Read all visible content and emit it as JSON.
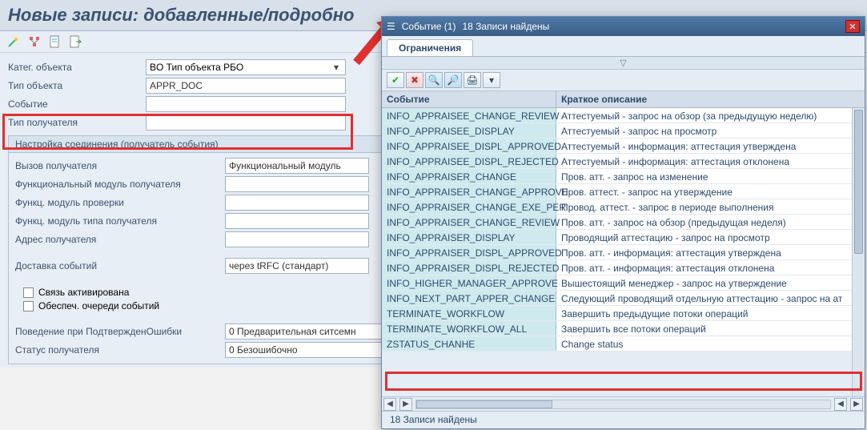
{
  "page_title": "Новые записи: добавленные/подробно",
  "toolbar_icons": [
    "wand-icon",
    "structure-icon",
    "document-icon",
    "forward-icon"
  ],
  "form": {
    "object_category_label": "Катег. объекта",
    "object_category_value": "BO Тип объекта РБО",
    "object_type_label": "Тип объекта",
    "object_type_value": "APPR_DOC",
    "event_label": "Событие",
    "event_value": "",
    "receiver_type_label": "Тип получателя",
    "receiver_type_value": ""
  },
  "group": {
    "header": "Настройка соединения (получатель события)",
    "rows": [
      {
        "label": "Вызов получателя",
        "value": "Функциональный модуль"
      },
      {
        "label": "Функциональный модуль получателя",
        "value": ""
      },
      {
        "label": "Функц. модуль проверки",
        "value": ""
      },
      {
        "label": "Функц. модуль типа получателя",
        "value": ""
      },
      {
        "label": "Адрес получателя",
        "value": ""
      }
    ],
    "delivery_label": "Доставка событий",
    "delivery_value": "через tRFC (стандарт)",
    "chk1": "Связь активирована",
    "chk2": "Обеспеч. очереди событий",
    "behavior_label": "Поведение при ПодтвержденОшибки",
    "behavior_value": "0 Предварительная ситсемн",
    "status_label": "Статус получателя",
    "status_value": "0 Безошибочно"
  },
  "dialog": {
    "title_prefix": "Событие (1)",
    "title_count": "18 Записи найдены",
    "tab": "Ограничения",
    "col_event": "Событие",
    "col_desc": "Краткое описание",
    "rows": [
      {
        "evt": "INFO_APPRAISEE_CHANGE_REVIEW",
        "desc": "Аттестуемый - запрос на обзор (за предыдущую неделю)"
      },
      {
        "evt": "INFO_APPRAISEE_DISPLAY",
        "desc": "Аттестуемый - запрос на просмотр"
      },
      {
        "evt": "INFO_APPRAISEE_DISPL_APPROVED",
        "desc": "Аттестуемый - информация: аттестация утверждена"
      },
      {
        "evt": "INFO_APPRAISEE_DISPL_REJECTED",
        "desc": "Аттестуемый - информация: аттестация отклонена"
      },
      {
        "evt": "INFO_APPRAISER_CHANGE",
        "desc": "Пров. атт. - запрос на изменение"
      },
      {
        "evt": "INFO_APPRAISER_CHANGE_APPROVE",
        "desc": "Пров. аттест. - запрос на утверждение"
      },
      {
        "evt": "INFO_APPRAISER_CHANGE_EXE_PER",
        "desc": "Провод. аттест. - запрос в периоде выполнения"
      },
      {
        "evt": "INFO_APPRAISER_CHANGE_REVIEW",
        "desc": "Пров. атт. - запрос на обзор (предыдущая неделя)"
      },
      {
        "evt": "INFO_APPRAISER_DISPLAY",
        "desc": "Проводящий аттестацию - запрос на просмотр"
      },
      {
        "evt": "INFO_APPRAISER_DISPL_APPROVED",
        "desc": "Пров. атт. - информация: аттестация утверждена"
      },
      {
        "evt": "INFO_APPRAISER_DISPL_REJECTED",
        "desc": "Пров. атт. - информация: аттестация отклонена"
      },
      {
        "evt": "INFO_HIGHER_MANAGER_APPROVE",
        "desc": "Вышестоящий менеджер - запрос на утверждение"
      },
      {
        "evt": "INFO_NEXT_PART_APPER_CHANGE",
        "desc": "Следующий проводящий отдельную аттестацию - запрос на ат"
      },
      {
        "evt": "TERMINATE_WORKFLOW",
        "desc": "Завершить предыдущие потоки операций"
      },
      {
        "evt": "TERMINATE_WORKFLOW_ALL",
        "desc": "Завершить все потоки операций"
      },
      {
        "evt": "ZSTATUS_CHANHE",
        "desc": "Change status"
      }
    ],
    "status": "18 Записи найдены"
  }
}
